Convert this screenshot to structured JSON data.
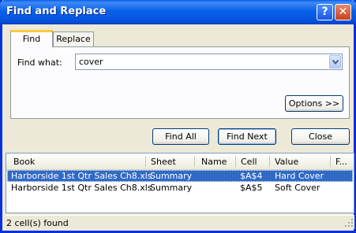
{
  "window": {
    "title": "Find and Replace",
    "help": "?",
    "close": "✕"
  },
  "tabs": [
    {
      "label": "Find"
    },
    {
      "label": "Replace"
    }
  ],
  "find": {
    "label": "Find what:",
    "value": "cover",
    "options_label": "Options >>"
  },
  "buttons": {
    "find_all": "Find All",
    "find_next": "Find Next",
    "close": "Close"
  },
  "results": {
    "columns": [
      "Book",
      "Sheet",
      "Name",
      "Cell",
      "Value",
      "F..."
    ],
    "rows": [
      {
        "book": "Harborside 1st Qtr Sales Ch8.xls",
        "sheet": "Summary",
        "name": "",
        "cell": "$A$4",
        "value": "Hard Cover",
        "formula": "",
        "selected": true
      },
      {
        "book": "Harborside 1st Qtr Sales Ch8.xls",
        "sheet": "Summary",
        "name": "",
        "cell": "$A$5",
        "value": "Soft Cover",
        "formula": "",
        "selected": false
      }
    ]
  },
  "status": "2 cell(s) found",
  "colors": {
    "title_bar": "#0a5fe8",
    "selection": "#316ac5",
    "tab_highlight": "#ffc83c"
  }
}
